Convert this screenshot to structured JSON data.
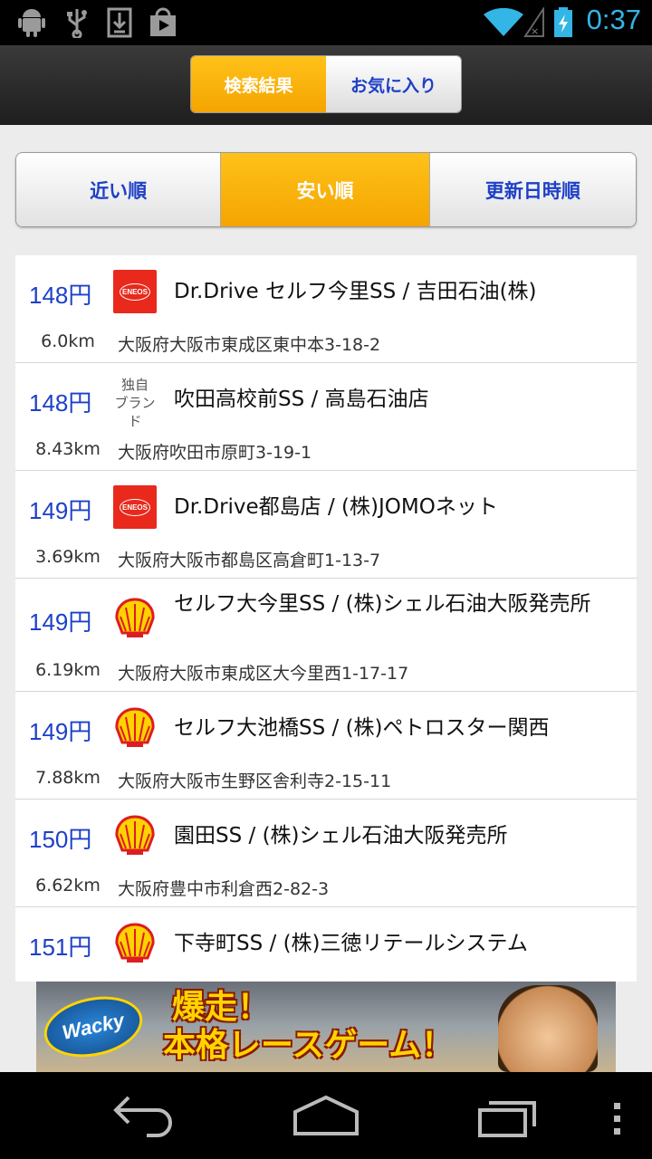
{
  "status_bar": {
    "time": "0:37",
    "icons": [
      "android-icon",
      "usb-icon",
      "download-icon",
      "play-store-icon",
      "wifi-icon",
      "no-signal-icon",
      "battery-charging-icon"
    ]
  },
  "header": {
    "tabs": [
      {
        "label": "検索結果",
        "active": true
      },
      {
        "label": "お気に入り",
        "active": false
      }
    ]
  },
  "sort_tabs": [
    {
      "label": "近い順",
      "active": false
    },
    {
      "label": "安い順",
      "active": true
    },
    {
      "label": "更新日時順",
      "active": false
    }
  ],
  "stations": [
    {
      "price": "148円",
      "brand": "ENEOS",
      "logo_icon": "eneos-logo-icon",
      "name": "Dr.Drive セルフ今里SS / 吉田石油(株)",
      "distance": "6.0km",
      "address": "大阪府大阪市東成区東中本3-18-2"
    },
    {
      "price": "148円",
      "brand": "独自ブランド",
      "brand_line1": "独自",
      "brand_line2": "ブランド",
      "logo_icon": "independent-brand-icon",
      "name": "吹田高校前SS / 高島石油店",
      "distance": "8.43km",
      "address": "大阪府吹田市原町3-19-1"
    },
    {
      "price": "149円",
      "brand": "ENEOS",
      "logo_icon": "eneos-logo-icon",
      "name": "Dr.Drive都島店 / (株)JOMOネット",
      "distance": "3.69km",
      "address": "大阪府大阪市都島区高倉町1-13-7"
    },
    {
      "price": "149円",
      "brand": "Shell",
      "logo_icon": "shell-logo-icon",
      "name": "セルフ大今里SS / (株)シェル石油大阪発売所",
      "distance": "6.19km",
      "address": "大阪府大阪市東成区大今里西1-17-17"
    },
    {
      "price": "149円",
      "brand": "Shell",
      "logo_icon": "shell-logo-icon",
      "name": "セルフ大池橋SS / (株)ペトロスター関西",
      "distance": "7.88km",
      "address": "大阪府大阪市生野区舎利寺2-15-11"
    },
    {
      "price": "150円",
      "brand": "Shell",
      "logo_icon": "shell-logo-icon",
      "name": "園田SS / (株)シェル石油大阪発売所",
      "distance": "6.62km",
      "address": "大阪府豊中市利倉西2-82-3"
    },
    {
      "price": "151円",
      "brand": "Shell",
      "logo_icon": "shell-logo-icon",
      "name": "下寺町SS / (株)三徳リテールシステム",
      "distance": "",
      "address": ""
    }
  ],
  "ad": {
    "logo_text": "Wacky",
    "headline_line1": "爆走！",
    "headline_line2": "本格レースゲーム！"
  },
  "nav_bar": {
    "icons": [
      "back-icon",
      "home-icon",
      "recent-apps-icon",
      "menu-icon"
    ]
  },
  "colors": {
    "accent": "#f5a400",
    "link_blue": "#1e40c8",
    "status_blue": "#33b5e5",
    "eneos_red": "#e8291c",
    "shell_yellow": "#ffd200",
    "shell_red": "#dd1d21"
  }
}
